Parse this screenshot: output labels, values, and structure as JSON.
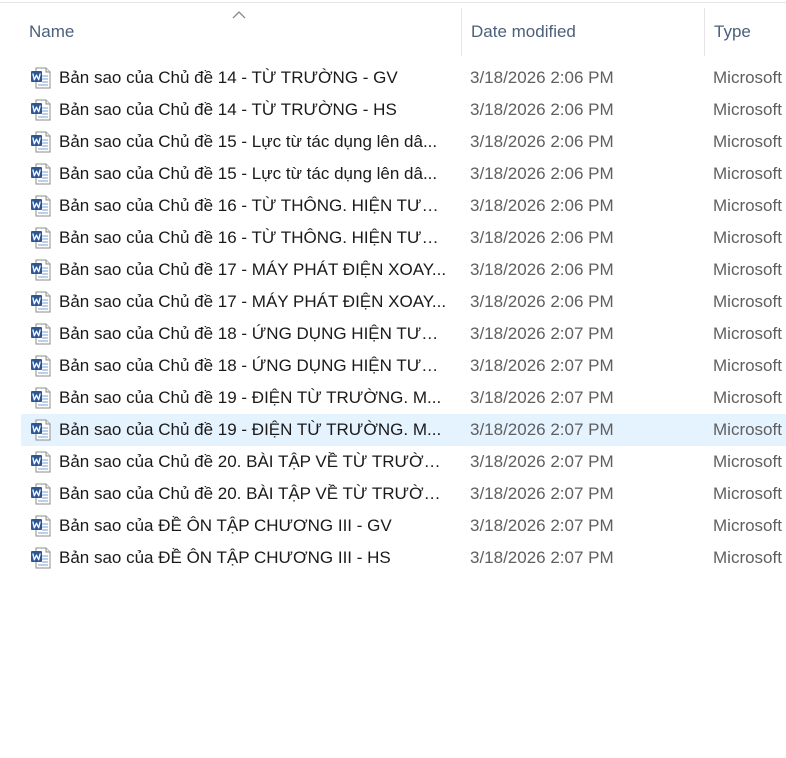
{
  "columns": {
    "name": "Name",
    "date_modified": "Date modified",
    "type": "Type"
  },
  "sort": {
    "column": "name",
    "direction": "ascending",
    "icon": "chevron-up-icon"
  },
  "file_icon": "word-document-icon",
  "colors": {
    "header_text": "#4c607a",
    "selected_row": "#e5f3ff",
    "word_blue": "#2b5797"
  },
  "files": [
    {
      "name": "Bản sao của Chủ đề 14 - TỪ TRƯỜNG - GV",
      "date": "3/18/2026 2:06 PM",
      "type": "Microsoft"
    },
    {
      "name": "Bản sao của Chủ đề 14 - TỪ TRƯỜNG - HS",
      "date": "3/18/2026 2:06 PM",
      "type": "Microsoft"
    },
    {
      "name": "Bản sao của Chủ đề 15 - Lực từ tác dụng lên dâ...",
      "date": "3/18/2026 2:06 PM",
      "type": "Microsoft"
    },
    {
      "name": "Bản sao của Chủ đề 15 - Lực từ tác dụng lên dâ...",
      "date": "3/18/2026 2:06 PM",
      "type": "Microsoft"
    },
    {
      "name": "Bản sao của Chủ đề 16 - TỪ THÔNG. HIỆN TƯỢ...",
      "date": "3/18/2026 2:06 PM",
      "type": "Microsoft"
    },
    {
      "name": "Bản sao của Chủ đề 16 - TỪ THÔNG. HIỆN TƯỢ...",
      "date": "3/18/2026 2:06 PM",
      "type": "Microsoft"
    },
    {
      "name": "Bản sao của Chủ đề 17 - MÁY PHÁT ĐIỆN XOAY...",
      "date": "3/18/2026 2:06 PM",
      "type": "Microsoft"
    },
    {
      "name": "Bản sao của Chủ đề 17 - MÁY PHÁT ĐIỆN XOAY...",
      "date": "3/18/2026 2:06 PM",
      "type": "Microsoft"
    },
    {
      "name": "Bản sao của Chủ đề 18 - ỨNG DỤNG HIỆN TƯỢ...",
      "date": "3/18/2026 2:07 PM",
      "type": "Microsoft"
    },
    {
      "name": "Bản sao của Chủ đề 18 - ỨNG DỤNG HIỆN TƯỢ...",
      "date": "3/18/2026 2:07 PM",
      "type": "Microsoft"
    },
    {
      "name": "Bản sao của Chủ đề 19 - ĐIỆN TỪ TRƯỜNG. M...",
      "date": "3/18/2026 2:07 PM",
      "type": "Microsoft"
    },
    {
      "name": "Bản sao của Chủ đề 19 - ĐIỆN TỪ TRƯỜNG. M...",
      "date": "3/18/2026 2:07 PM",
      "type": "Microsoft",
      "selected": true
    },
    {
      "name": "Bản sao của Chủ đề 20. BÀI TẬP VỀ TỪ TRƯỜN...",
      "date": "3/18/2026 2:07 PM",
      "type": "Microsoft"
    },
    {
      "name": "Bản sao của Chủ đề 20. BÀI TẬP VỀ TỪ TRƯỜN...",
      "date": "3/18/2026 2:07 PM",
      "type": "Microsoft"
    },
    {
      "name": "Bản sao của ĐỀ ÔN TẬP CHƯƠNG III - GV",
      "date": "3/18/2026 2:07 PM",
      "type": "Microsoft"
    },
    {
      "name": "Bản sao của ĐỀ ÔN TẬP CHƯƠNG III - HS",
      "date": "3/18/2026 2:07 PM",
      "type": "Microsoft"
    }
  ]
}
